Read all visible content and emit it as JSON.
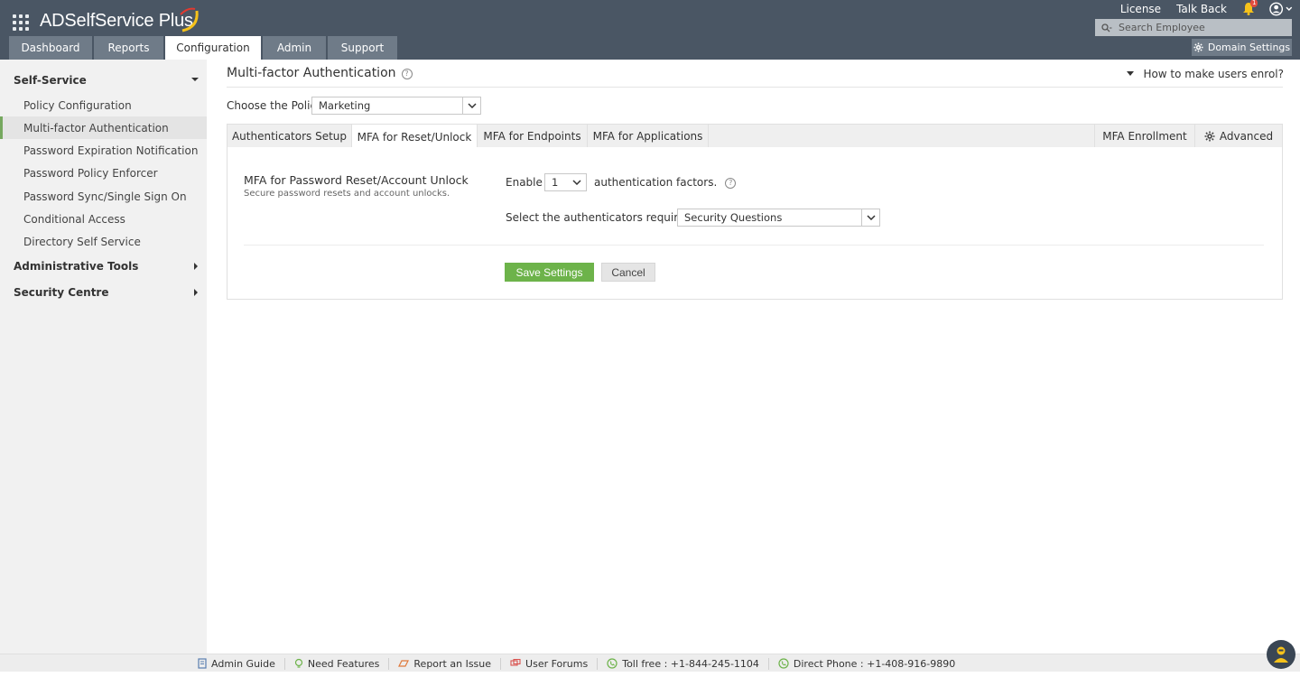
{
  "header": {
    "app_name": "ADSelfService Plus",
    "top_links": [
      "License",
      "Talk Back"
    ],
    "notification_count": "1",
    "search_placeholder": "Search Employee",
    "domain_settings": "Domain Settings",
    "nav_tabs": [
      "Dashboard",
      "Reports",
      "Configuration",
      "Admin",
      "Support"
    ],
    "active_tab": "Configuration"
  },
  "sidebar": {
    "sections": [
      {
        "label": "Self-Service",
        "expanded": true
      },
      {
        "label": "Administrative Tools",
        "expanded": false
      },
      {
        "label": "Security Centre",
        "expanded": false
      }
    ],
    "items": [
      "Policy Configuration",
      "Multi-factor Authentication",
      "Password Expiration Notification",
      "Password Policy Enforcer",
      "Password Sync/Single Sign On",
      "Conditional Access",
      "Directory Self Service"
    ],
    "active_item": "Multi-factor Authentication"
  },
  "main": {
    "title": "Multi-factor Authentication",
    "enrol_link": "How to make users enrol?",
    "policy_label": "Choose the Policy",
    "policy_value": "Marketing",
    "tabs": [
      "Authenticators Setup",
      "MFA for Reset/Unlock",
      "MFA for Endpoints",
      "MFA for Applications"
    ],
    "active_tab": "MFA for Reset/Unlock",
    "right_tabs": [
      "MFA Enrollment",
      "Advanced"
    ],
    "section_title": "MFA for Password Reset/Account Unlock",
    "section_subtitle": "Secure password resets and account unlocks.",
    "enable_label": "Enable",
    "factor_count": "1",
    "factors_label": "authentication factors.",
    "authenticators_label": "Select the authenticators required",
    "authenticators_value": "Security Questions",
    "save_label": "Save Settings",
    "cancel_label": "Cancel"
  },
  "footer": {
    "links": [
      "Admin Guide",
      "Need Features",
      "Report an Issue",
      "User Forums",
      "Toll free : +1-844-245-1104",
      "Direct Phone : +1-408-916-9890"
    ]
  },
  "colors": {
    "header_bg": "#4a5664",
    "tab_bg": "#6f7b88",
    "save_green": "#6db34a",
    "active_item_border": "#76a85f"
  }
}
